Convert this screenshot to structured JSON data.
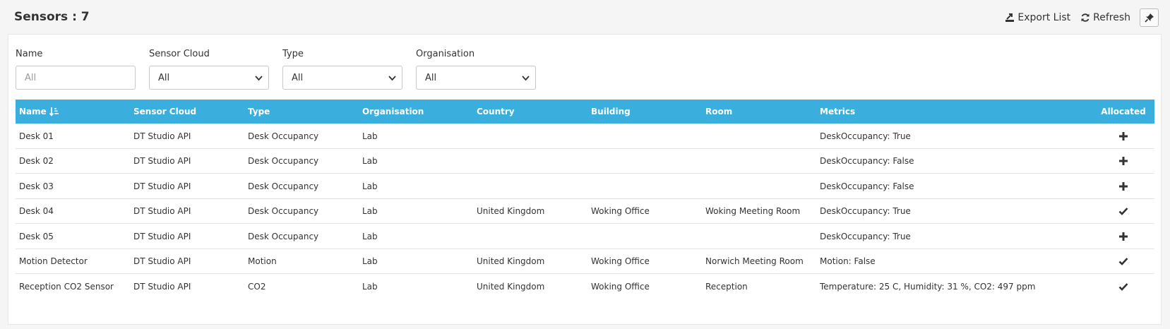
{
  "header": {
    "title": "Sensors : 7",
    "export_label": "Export List",
    "refresh_label": "Refresh"
  },
  "filters": [
    {
      "label": "Name",
      "kind": "input",
      "placeholder": "All"
    },
    {
      "label": "Sensor Cloud",
      "kind": "select",
      "value": "All"
    },
    {
      "label": "Type",
      "kind": "select",
      "value": "All"
    },
    {
      "label": "Organisation",
      "kind": "select",
      "value": "All"
    }
  ],
  "table": {
    "columns": [
      "Name",
      "Sensor Cloud",
      "Type",
      "Organisation",
      "Country",
      "Building",
      "Room",
      "Metrics",
      "Allocated"
    ],
    "sort_icon": "sort-ascending-icon",
    "rows": [
      {
        "name": "Desk 01",
        "cloud": "DT Studio API",
        "type": "Desk Occupancy",
        "org": "Lab",
        "country": "",
        "building": "",
        "room": "",
        "metrics": "DeskOccupancy: True",
        "allocated": false
      },
      {
        "name": "Desk 02",
        "cloud": "DT Studio API",
        "type": "Desk Occupancy",
        "org": "Lab",
        "country": "",
        "building": "",
        "room": "",
        "metrics": "DeskOccupancy: False",
        "allocated": false
      },
      {
        "name": "Desk 03",
        "cloud": "DT Studio API",
        "type": "Desk Occupancy",
        "org": "Lab",
        "country": "",
        "building": "",
        "room": "",
        "metrics": "DeskOccupancy: False",
        "allocated": false
      },
      {
        "name": "Desk 04",
        "cloud": "DT Studio API",
        "type": "Desk Occupancy",
        "org": "Lab",
        "country": "United Kingdom",
        "building": "Woking Office",
        "room": "Woking Meeting Room",
        "metrics": "DeskOccupancy: True",
        "allocated": true
      },
      {
        "name": "Desk 05",
        "cloud": "DT Studio API",
        "type": "Desk Occupancy",
        "org": "Lab",
        "country": "",
        "building": "",
        "room": "",
        "metrics": "DeskOccupancy: True",
        "allocated": false
      },
      {
        "name": "Motion Detector",
        "cloud": "DT Studio API",
        "type": "Motion",
        "org": "Lab",
        "country": "United Kingdom",
        "building": "Woking Office",
        "room": "Norwich Meeting Room",
        "metrics": "Motion: False",
        "allocated": true
      },
      {
        "name": "Reception CO2 Sensor",
        "cloud": "DT Studio API",
        "type": "CO2",
        "org": "Lab",
        "country": "United Kingdom",
        "building": "Woking Office",
        "room": "Reception",
        "metrics": "Temperature: 25 C, Humidity: 31 %, CO2: 497 ppm",
        "allocated": true
      }
    ]
  }
}
